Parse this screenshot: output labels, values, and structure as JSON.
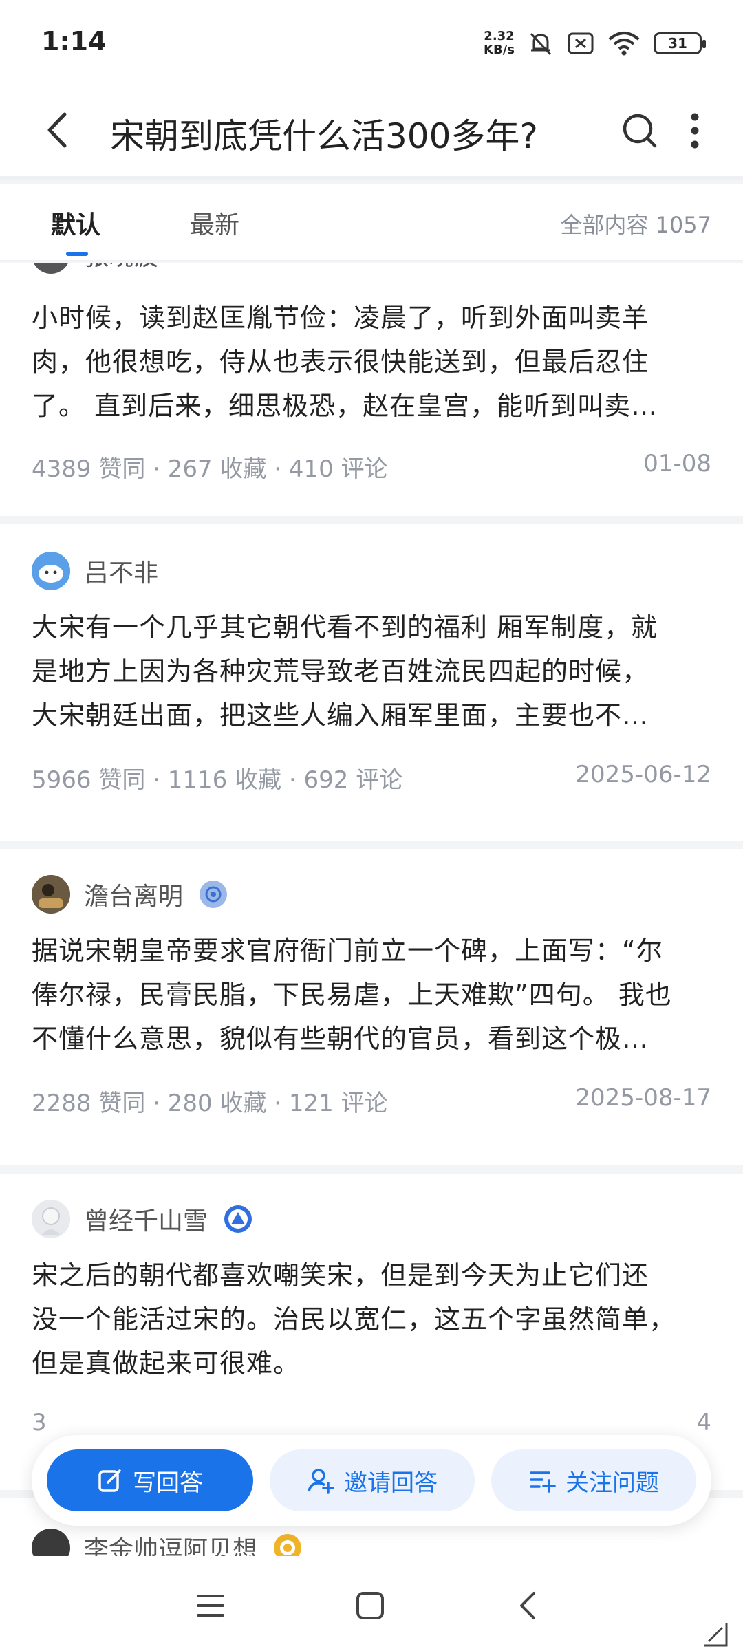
{
  "status": {
    "time": "1:14",
    "speed_value": "2.32",
    "speed_unit": "KB/s",
    "battery": "31"
  },
  "header": {
    "title": "宋朝到底凭什么活300多年?"
  },
  "tabs": {
    "default": "默认",
    "latest": "最新",
    "total": "全部内容 1057"
  },
  "answers": [
    {
      "author": "张晓波",
      "lines": [
        "小时候，读到赵匡胤节俭：凌晨了，听到外面叫卖羊",
        "肉，他很想吃，侍从也表示很快能送到，但最后忍住",
        "了。 直到后来，细思极恐，赵在皇宫，能听到叫卖…"
      ],
      "meta": "4389 赞同 · 267 收藏 · 410 评论",
      "date": "01-08"
    },
    {
      "author": "吕不非",
      "lines": [
        "大宋有一个几乎其它朝代看不到的福利 厢军制度，就",
        "是地方上因为各种灾荒导致老百姓流民四起的时候，",
        "大宋朝廷出面，把这些人编入厢军里面，主要也不…"
      ],
      "meta": "5966 赞同 · 1116 收藏 · 692 评论",
      "date": "2025-06-12"
    },
    {
      "author": "澹台离明",
      "lines": [
        "据说宋朝皇帝要求官府衙门前立一个碑，上面写：“尔",
        "俸尔禄，民膏民脂，下民易虐，上天难欺”四句。 我也",
        "不懂什么意思，貌似有些朝代的官员，看到这个极…"
      ],
      "meta": "2288 赞同 · 280 收藏 · 121 评论",
      "date": "2025-08-17"
    },
    {
      "author": "曾经千山雪",
      "lines": [
        "宋之后的朝代都喜欢嘲笑宋，但是到今天为止它们还",
        "没一个能活过宋的。治民以宽仁，这五个字虽然简单，",
        "但是真做起来可很难。"
      ],
      "meta": "3",
      "date": "4"
    },
    {
      "author": "李金帅逗阿贝想"
    }
  ],
  "actions": {
    "write": "写回答",
    "invite": "邀请回答",
    "follow": "关注问题"
  },
  "colors": {
    "accent": "#1a73e8",
    "muted": "#9499a3"
  }
}
